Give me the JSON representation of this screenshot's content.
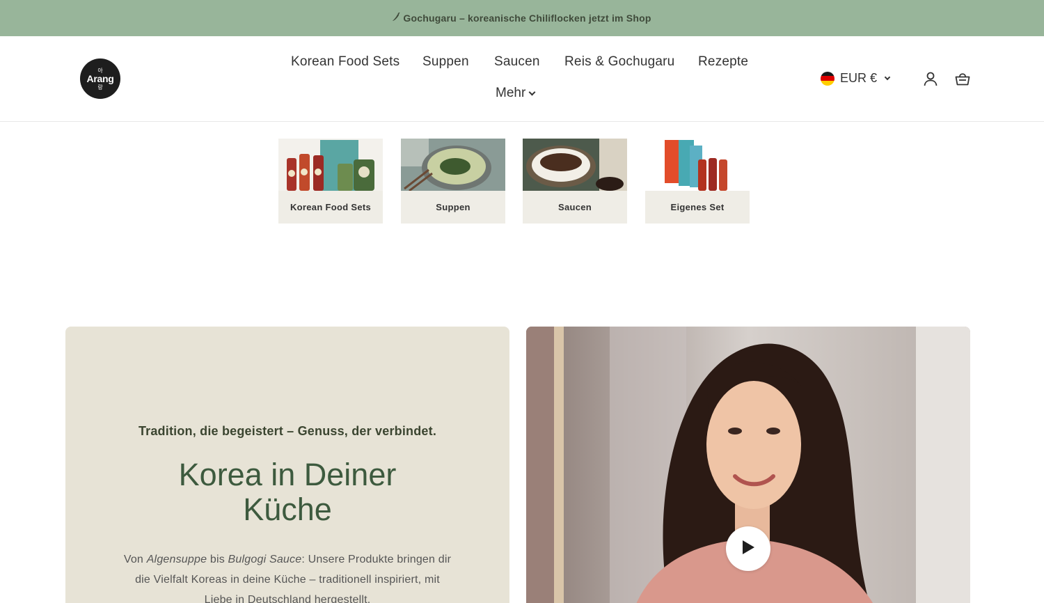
{
  "announcement": {
    "icon": "chili-icon",
    "text": "Gochugaru – koreanische Chiliflocken jetzt im Shop"
  },
  "header": {
    "logo": {
      "top": "아",
      "main": "Arang",
      "bottom": "랑"
    },
    "nav": [
      {
        "label": "Korean Food Sets"
      },
      {
        "label": "Suppen"
      },
      {
        "label": "Saucen"
      },
      {
        "label": "Reis & Gochugaru"
      },
      {
        "label": "Rezepte"
      },
      {
        "label": "Mehr"
      }
    ],
    "currency": {
      "label": "EUR €",
      "flag": "germany-flag-icon"
    },
    "icons": [
      "account-icon",
      "cart-icon"
    ]
  },
  "categories": [
    {
      "label": "Korean Food Sets"
    },
    {
      "label": "Suppen"
    },
    {
      "label": "Saucen"
    },
    {
      "label": "Eigenes Set"
    }
  ],
  "hero": {
    "subtitle": "Tradition, die begeistert – Genuss, der verbindet.",
    "title_line1": "Korea in Deiner",
    "title_line2": "Küche",
    "desc_pre": "Von ",
    "desc_em1": "Algensuppe",
    "desc_mid": " bis ",
    "desc_em2": "Bulgogi Sauce",
    "desc_post": ": Unsere Produkte bringen dir die Vielfalt Koreas in deine Küche – traditionell inspiriert, mit Liebe in Deutschland hergestellt.",
    "video_icon": "play-icon"
  },
  "colors": {
    "announce_bg": "#98b59a",
    "hero_panel_bg": "#e7e3d6",
    "hero_title": "#3d5a3e",
    "tile_bg": "#efede6"
  }
}
